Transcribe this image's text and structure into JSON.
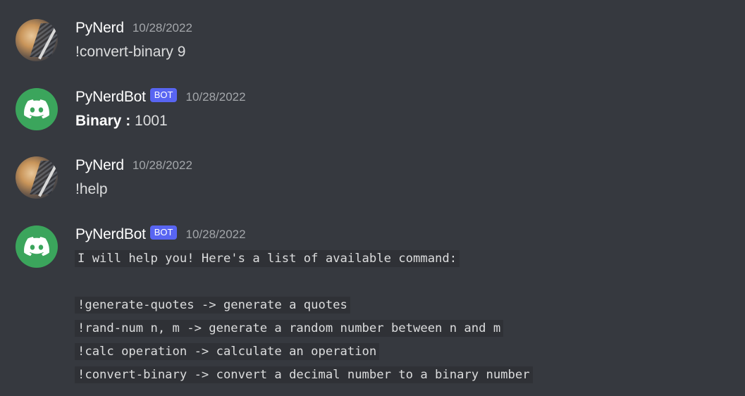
{
  "messages": [
    {
      "author": "PyNerd",
      "timestamp": "10/28/2022",
      "avatar": "user-photo-avatar",
      "content": "!convert-binary 9"
    },
    {
      "author": "PyNerdBot",
      "bot_tag": "BOT",
      "timestamp": "10/28/2022",
      "avatar": "discord-logo-icon",
      "content_label": "Binary :",
      "content_value": " 1001"
    },
    {
      "author": "PyNerd",
      "timestamp": "10/28/2022",
      "avatar": "user-photo-avatar",
      "content": "!help"
    },
    {
      "author": "PyNerdBot",
      "bot_tag": "BOT",
      "timestamp": "10/28/2022",
      "avatar": "discord-logo-icon",
      "code_intro": "I will help you! Here's a list of available command:",
      "code_lines": [
        "!generate-quotes -> generate a quotes",
        "!rand-num n, m -> generate a random number between n and m",
        "!calc operation -> calculate an operation",
        "!convert-binary -> convert a decimal number to a binary number"
      ]
    }
  ],
  "colors": {
    "background": "#36393f",
    "bot_tag": "#5865f2",
    "bot_avatar": "#3ba55c",
    "codeblock": "#2f3136",
    "timestamp": "#a3a6aa"
  }
}
